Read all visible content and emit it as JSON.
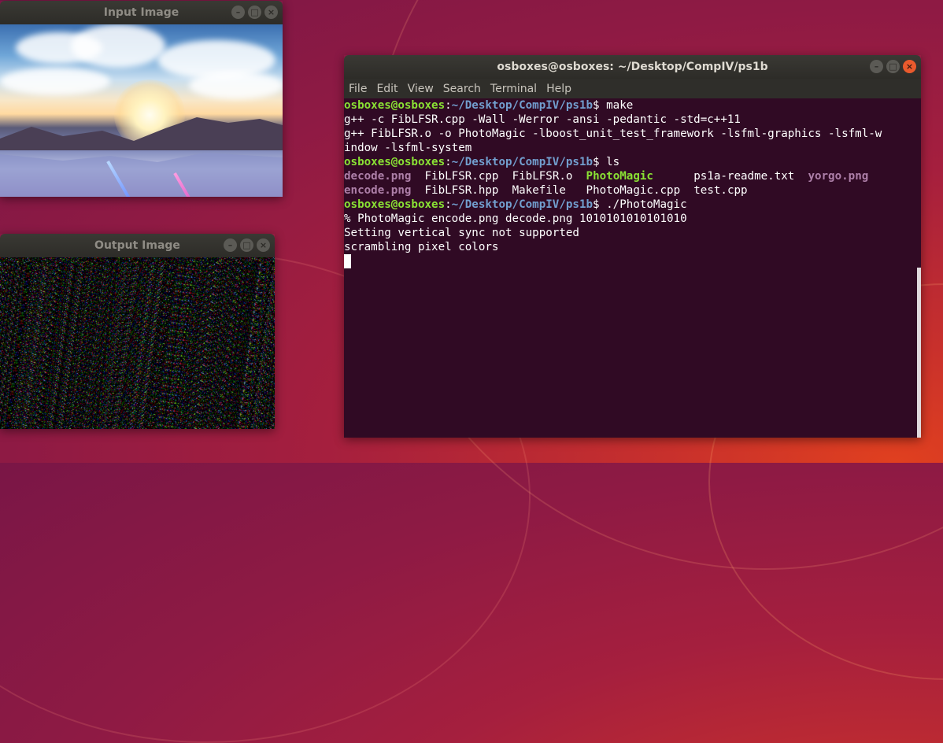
{
  "input_window": {
    "title": "Input Image"
  },
  "output_window": {
    "title": "Output Image"
  },
  "terminal": {
    "title": "osboxes@osboxes: ~/Desktop/CompIV/ps1b",
    "menu": [
      "File",
      "Edit",
      "View",
      "Search",
      "Terminal",
      "Help"
    ],
    "prompt_user": "osboxes@osboxes",
    "prompt_sep": ":",
    "prompt_path": "~/Desktop/CompIV/ps1b",
    "prompt_end": "$ ",
    "commands": [
      "make",
      "ls",
      "./PhotoMagic"
    ],
    "make_output": [
      "g++ -c FibLFSR.cpp -Wall -Werror -ansi -pedantic -std=c++11",
      "g++ FibLFSR.o -o PhotoMagic -lboost_unit_test_framework -lsfml-graphics -lsfml-w",
      "indow -lsfml-system"
    ],
    "ls_row1": [
      {
        "name": "decode.png",
        "kind": "image",
        "pad": "  "
      },
      {
        "name": "FibLFSR.cpp",
        "kind": "plain",
        "pad": "  "
      },
      {
        "name": "FibLFSR.o",
        "kind": "plain",
        "pad": "  "
      },
      {
        "name": "PhotoMagic",
        "kind": "exec",
        "pad": "      "
      },
      {
        "name": "ps1a-readme.txt",
        "kind": "plain",
        "pad": "  "
      },
      {
        "name": "yorgo.png",
        "kind": "image",
        "pad": ""
      }
    ],
    "ls_row2": [
      {
        "name": "encode.png",
        "kind": "image",
        "pad": "  "
      },
      {
        "name": "FibLFSR.hpp",
        "kind": "plain",
        "pad": "  "
      },
      {
        "name": "Makefile",
        "kind": "plain",
        "pad": "   "
      },
      {
        "name": "PhotoMagic.cpp",
        "kind": "plain",
        "pad": "  "
      },
      {
        "name": "test.cpp",
        "kind": "plain",
        "pad": ""
      }
    ],
    "run_output": [
      "% PhotoMagic encode.png decode.png 1010101010101010",
      "Setting vertical sync not supported",
      "scrambling pixel colors"
    ]
  },
  "window_controls": {
    "minimize": "–",
    "maximize": "□",
    "close": "×"
  },
  "colors": {
    "terminal_bg": "#300a24",
    "prompt_user": "#8ae234",
    "prompt_path": "#729fcf",
    "image_file": "#ad7fa8",
    "executable": "#8ae234"
  }
}
